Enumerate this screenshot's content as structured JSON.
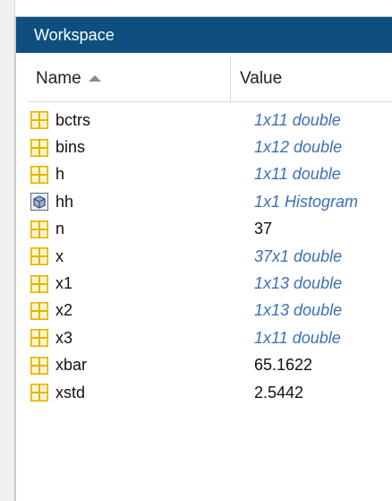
{
  "panel": {
    "title": "Workspace"
  },
  "columns": {
    "name": "Name",
    "value": "Value"
  },
  "colors": {
    "titlebar": "#0e4f80",
    "object_value_text": "#3d6fb5",
    "grid_icon": "#e6b300"
  },
  "variables": [
    {
      "name": "bctrs",
      "value": "1x11 double",
      "icon": "matrix-icon",
      "style": "dim"
    },
    {
      "name": "bins",
      "value": "1x12 double",
      "icon": "matrix-icon",
      "style": "dim"
    },
    {
      "name": "h",
      "value": "1x11 double",
      "icon": "matrix-icon",
      "style": "dim"
    },
    {
      "name": "hh",
      "value": "1x1 Histogram",
      "icon": "object-icon",
      "style": "dim"
    },
    {
      "name": "n",
      "value": "37",
      "icon": "matrix-icon",
      "style": "plain"
    },
    {
      "name": "x",
      "value": "37x1 double",
      "icon": "matrix-icon",
      "style": "dim"
    },
    {
      "name": "x1",
      "value": "1x13 double",
      "icon": "matrix-icon",
      "style": "dim"
    },
    {
      "name": "x2",
      "value": "1x13 double",
      "icon": "matrix-icon",
      "style": "dim"
    },
    {
      "name": "x3",
      "value": "1x11 double",
      "icon": "matrix-icon",
      "style": "dim"
    },
    {
      "name": "xbar",
      "value": "65.1622",
      "icon": "matrix-icon",
      "style": "plain"
    },
    {
      "name": "xstd",
      "value": "2.5442",
      "icon": "matrix-icon",
      "style": "plain"
    }
  ]
}
